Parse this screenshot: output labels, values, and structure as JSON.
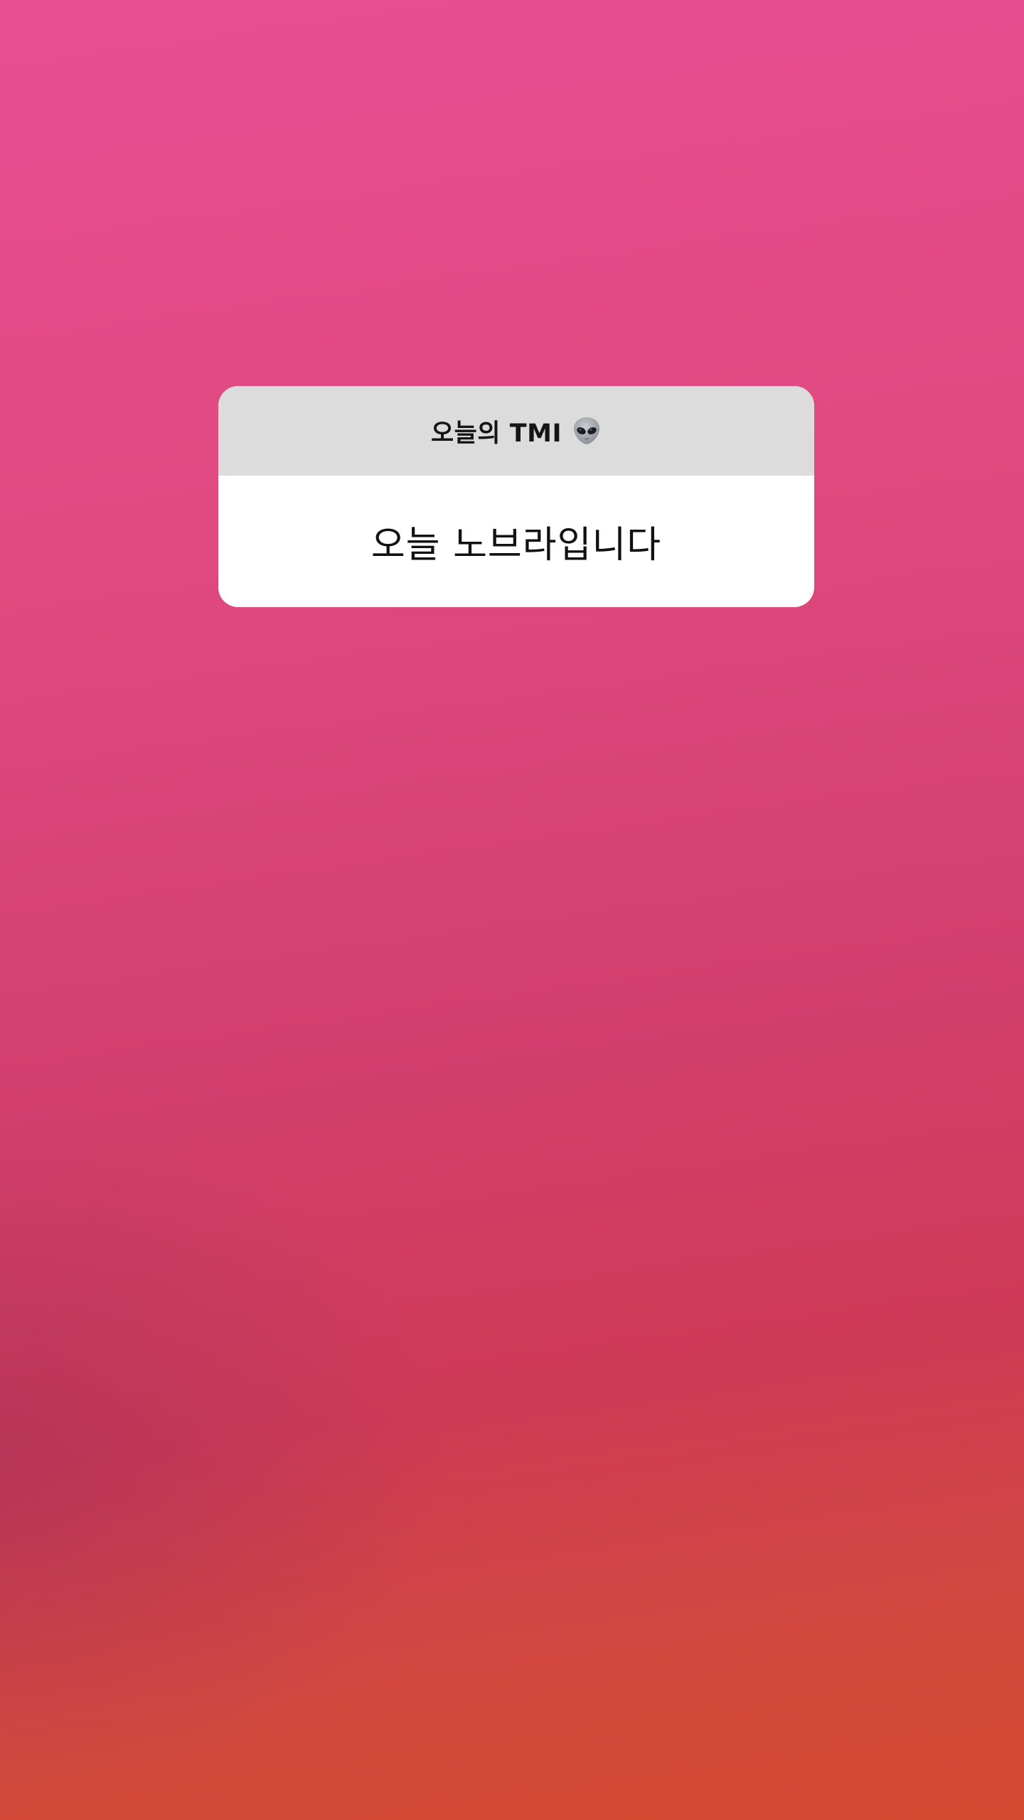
{
  "story": {
    "background_gradient": [
      "#e84d92",
      "#e0497f",
      "#d33f70",
      "#cf3a55",
      "#d54a32"
    ]
  },
  "qa_card": {
    "question": "오늘의 TMI",
    "question_icon": "alien-emoji-icon",
    "answer": "오늘 노브라입니다",
    "header_color": "#dcdcdc",
    "body_color": "#ffffff"
  }
}
